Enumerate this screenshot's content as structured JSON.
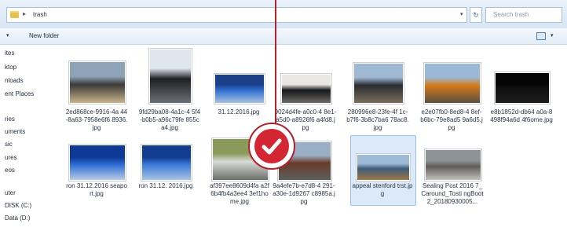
{
  "address_bar": {
    "breadcrumb_arrow": "▸",
    "path_label": "trash",
    "dropdown_arrow": "▾",
    "refresh_glyph": "↻",
    "search_placeholder": "Search trash"
  },
  "toolbar": {
    "organize_arrow": "▾",
    "new_folder_label": "New folder",
    "view_arrow": "▾"
  },
  "nav_pane": {
    "items": [
      "ites",
      "ktop",
      "nloads",
      "ent Places",
      "ries",
      "uments",
      "sic",
      "ures",
      "eos",
      "uter",
      "DISK (C:)",
      "Data (D:)"
    ]
  },
  "files": [
    {
      "name": "2ed868ce-9916-4a 44-8a63-7958e6f6 8936.jpg",
      "icon": "photo-icon",
      "colors": [
        "#8fa3b8",
        "#3b3a38",
        "#c9b48a"
      ]
    },
    {
      "name": "9fd29ba08-4a1c-4 5f4-b0b5-a96c79fe 855ca4.jpg",
      "icon": "photo-icon",
      "colors": [
        "#dfe6ee",
        "#1e1f22",
        "#6b7078"
      ]
    },
    {
      "name": "31.12.2016.jpg",
      "icon": "photo-icon",
      "colors": [
        "#1b3f88",
        "#2f6fd2",
        "#a8c0e0"
      ]
    },
    {
      "name": "9024d4fe-a0c0-4 8e1-a5d0-a8926f6 a4fd8.jpg",
      "icon": "photo-icon",
      "colors": [
        "#e9e7e2",
        "#16171a",
        "#6d6a66"
      ]
    },
    {
      "name": "280996e8-23fe-4f 1c-b7f6-3b8c7ba6 78ac8.jpg",
      "icon": "photo-icon",
      "colors": [
        "#9fb8d4",
        "#2a2c31",
        "#7b6e5b"
      ]
    },
    {
      "name": "e2e07fb0-8ed8-4 8ef-b6bc-79e8ad5 9a6d5.jpg",
      "icon": "photo-icon",
      "colors": [
        "#9bb8d6",
        "#d87a1c",
        "#5a4e3f"
      ]
    },
    {
      "name": "e8b1852d-db64 a0a-8498f94a6d 4f6ome.jpg",
      "icon": "photo-icon",
      "colors": [
        "#050505",
        "#121212",
        "#1c1c1c"
      ]
    },
    {
      "name": "ron 31.12.2016 seaport.jpg",
      "icon": "photo-icon",
      "colors": [
        "#0e3a95",
        "#2b6bd5",
        "#b9cce6"
      ]
    },
    {
      "name": "ron 31.12. 2016.jpg",
      "icon": "photo-icon",
      "colors": [
        "#123d8f",
        "#3a78d8",
        "#aac3e2"
      ]
    },
    {
      "name": "af397ee8609d4fa a2f6b4fb4a3ee4 3ef1home.jpg",
      "icon": "photo-icon",
      "colors": [
        "#8a9a5a",
        "#d8dbd8",
        "#6d6f6a"
      ]
    },
    {
      "name": "9a4efe7b-e7d8-4 291-a30e-1d9267 c8985a.jpg",
      "icon": "photo-icon",
      "colors": [
        "#9aaec6",
        "#6b3b2b",
        "#5a5f5a"
      ]
    },
    {
      "name": "appeal stenford trst.jpg",
      "icon": "photo-icon",
      "colors": [
        "#9dbad6",
        "#3f5b7a",
        "#a07844"
      ],
      "selected": true
    },
    {
      "name": "Sealing Post 2016 7_Caround_Tosti ngBoot 2_20180930005...",
      "icon": "photo-icon",
      "colors": [
        "#8d9396",
        "#5f5e58",
        "#c2c0ba"
      ]
    }
  ],
  "overlay": {
    "badge_icon": "checkmark-icon"
  }
}
